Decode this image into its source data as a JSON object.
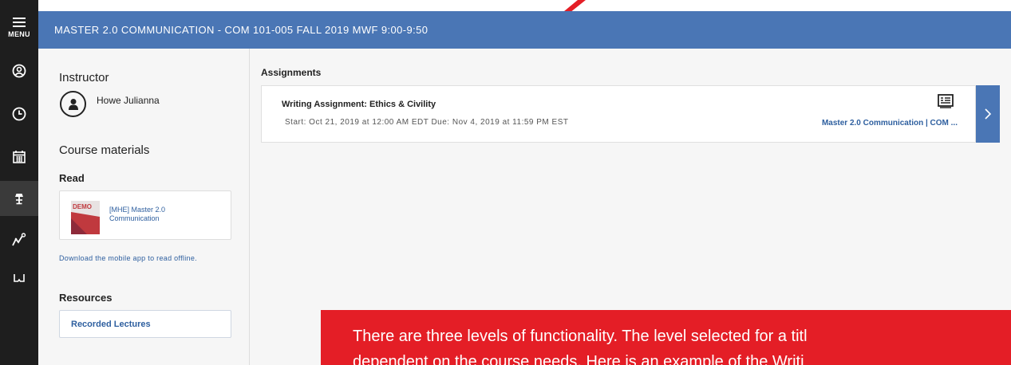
{
  "nav": {
    "menu_label": "MENU",
    "items": [
      "profile-icon",
      "clock-icon",
      "calendar-icon",
      "lamp-icon",
      "graph-icon",
      "glasses-icon"
    ],
    "active": "lamp-icon"
  },
  "header": {
    "title": "MASTER 2.0 COMMUNICATION - COM 101-005 FALL 2019 MWF 9:00-9:50"
  },
  "sidebar": {
    "instructor_heading": "Instructor",
    "instructor_name": "Howe Julianna",
    "materials_heading": "Course materials",
    "read_heading": "Read",
    "book": {
      "cover_badge": "DEMO",
      "title": "[MHE] Master 2.0 Communication"
    },
    "download_note": "Download the mobile app to read offline.",
    "resources_heading": "Resources",
    "resource_label": "Recorded Lectures"
  },
  "main": {
    "assignments_heading": "Assignments",
    "assignment": {
      "title": "Writing Assignment: Ethics & Civility",
      "dates": "Start: Oct 21, 2019 at 12:00 AM EDT  Due: Nov 4, 2019 at 11:59 PM EST",
      "course": "Master 2.0 Communication | COM ..."
    }
  },
  "callout": {
    "line1": "There are three levels of functionality. The level selected for a titl",
    "line2": "dependent on the course needs. Here is an example of the Writi"
  },
  "colors": {
    "header_blue": "#4a76b5",
    "rail_dark": "#1e1e1e",
    "link_blue": "#2e5f9f",
    "callout_red": "#e41e26"
  }
}
